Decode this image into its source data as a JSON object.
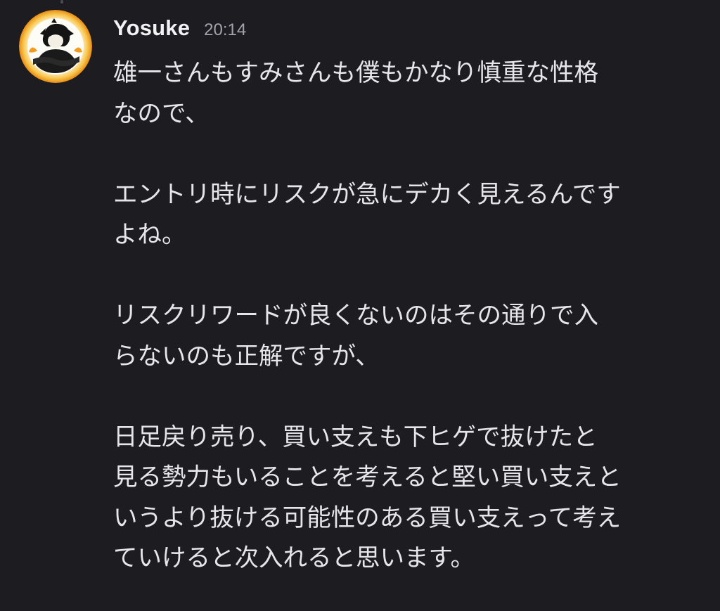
{
  "colors": {
    "background": "#1c1c21",
    "username": "#f2f2f5",
    "timestamp": "#a3a3ab",
    "text": "#e6e6ea",
    "avatar_ring": "#f4a622"
  },
  "message": {
    "author": "Yosuke",
    "timestamp": "20:14",
    "avatar_icon": "user-avatar",
    "lines": [
      "雄一さんもすみさんも僕もかなり慎重な性格",
      "なので、",
      "",
      "エントリ時にリスクが急にデカく見えるんです",
      "よね。",
      "",
      "リスクリワードが良くないのはその通りで入",
      "らないのも正解ですが、",
      "",
      "日足戻り売り、買い支えも下ヒゲで抜けたと",
      "見る勢力もいることを考えると堅い買い支えと",
      "いうより抜ける可能性のある買い支えって考え",
      "ていけると次入れると思います。"
    ]
  }
}
